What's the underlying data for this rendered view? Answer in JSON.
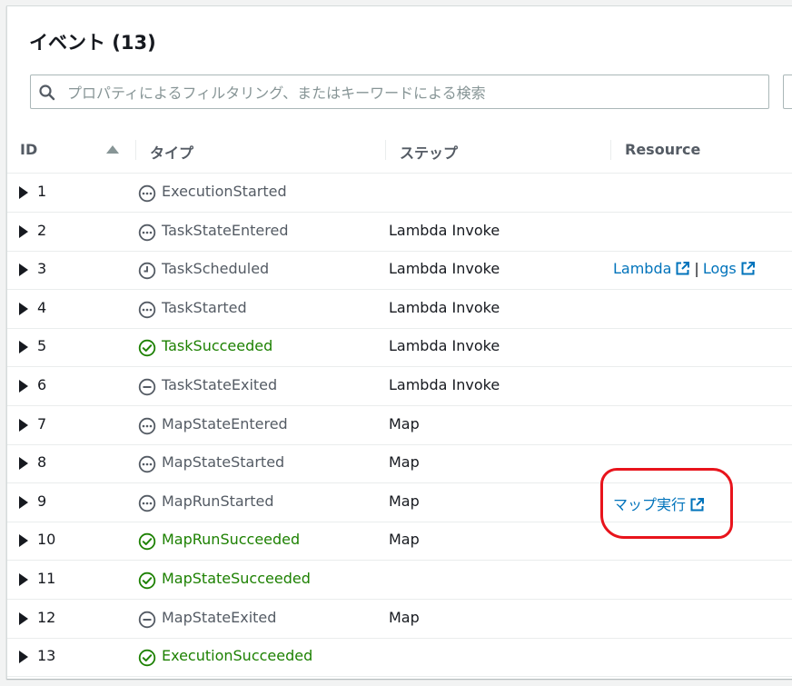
{
  "panel": {
    "title": "イベント (13)",
    "search": {
      "placeholder": "プロパティによるフィルタリング、またはキーワードによる検索",
      "value": ""
    }
  },
  "table": {
    "columns": [
      "ID",
      "タイプ",
      "ステップ",
      "Resource"
    ],
    "sort": {
      "column": "ID",
      "direction": "ascending"
    },
    "rows": [
      {
        "id": "1",
        "type": "ExecutionStarted",
        "status": "in-progress",
        "step": "",
        "resource": []
      },
      {
        "id": "2",
        "type": "TaskStateEntered",
        "status": "in-progress",
        "step": "Lambda Invoke",
        "resource": []
      },
      {
        "id": "3",
        "type": "TaskScheduled",
        "status": "scheduled",
        "step": "Lambda Invoke",
        "resource": [
          "Lambda",
          "Logs"
        ]
      },
      {
        "id": "4",
        "type": "TaskStarted",
        "status": "in-progress",
        "step": "Lambda Invoke",
        "resource": []
      },
      {
        "id": "5",
        "type": "TaskSucceeded",
        "status": "success",
        "step": "Lambda Invoke",
        "resource": []
      },
      {
        "id": "6",
        "type": "TaskStateExited",
        "status": "exited",
        "step": "Lambda Invoke",
        "resource": []
      },
      {
        "id": "7",
        "type": "MapStateEntered",
        "status": "in-progress",
        "step": "Map",
        "resource": []
      },
      {
        "id": "8",
        "type": "MapStateStarted",
        "status": "in-progress",
        "step": "Map",
        "resource": []
      },
      {
        "id": "9",
        "type": "MapRunStarted",
        "status": "in-progress",
        "step": "Map",
        "resource": [
          "マップ実行"
        ]
      },
      {
        "id": "10",
        "type": "MapRunSucceeded",
        "status": "success",
        "step": "Map",
        "resource": []
      },
      {
        "id": "11",
        "type": "MapStateSucceeded",
        "status": "success",
        "step": "",
        "resource": []
      },
      {
        "id": "12",
        "type": "MapStateExited",
        "status": "exited",
        "step": "Map",
        "resource": []
      },
      {
        "id": "13",
        "type": "ExecutionSucceeded",
        "status": "success",
        "step": "",
        "resource": []
      }
    ]
  },
  "colors": {
    "success": "#1d8102",
    "neutral": "#545b64",
    "link": "#0073bb",
    "annotation": "#e8141c"
  },
  "icons": {
    "in-progress": "ellipsis-circle-icon",
    "scheduled": "clock-icon",
    "success": "check-circle-icon",
    "exited": "minus-circle-icon",
    "external": "external-link-icon",
    "search": "search-icon",
    "expand": "caret-right-icon",
    "sort": "sort-ascending-icon"
  }
}
